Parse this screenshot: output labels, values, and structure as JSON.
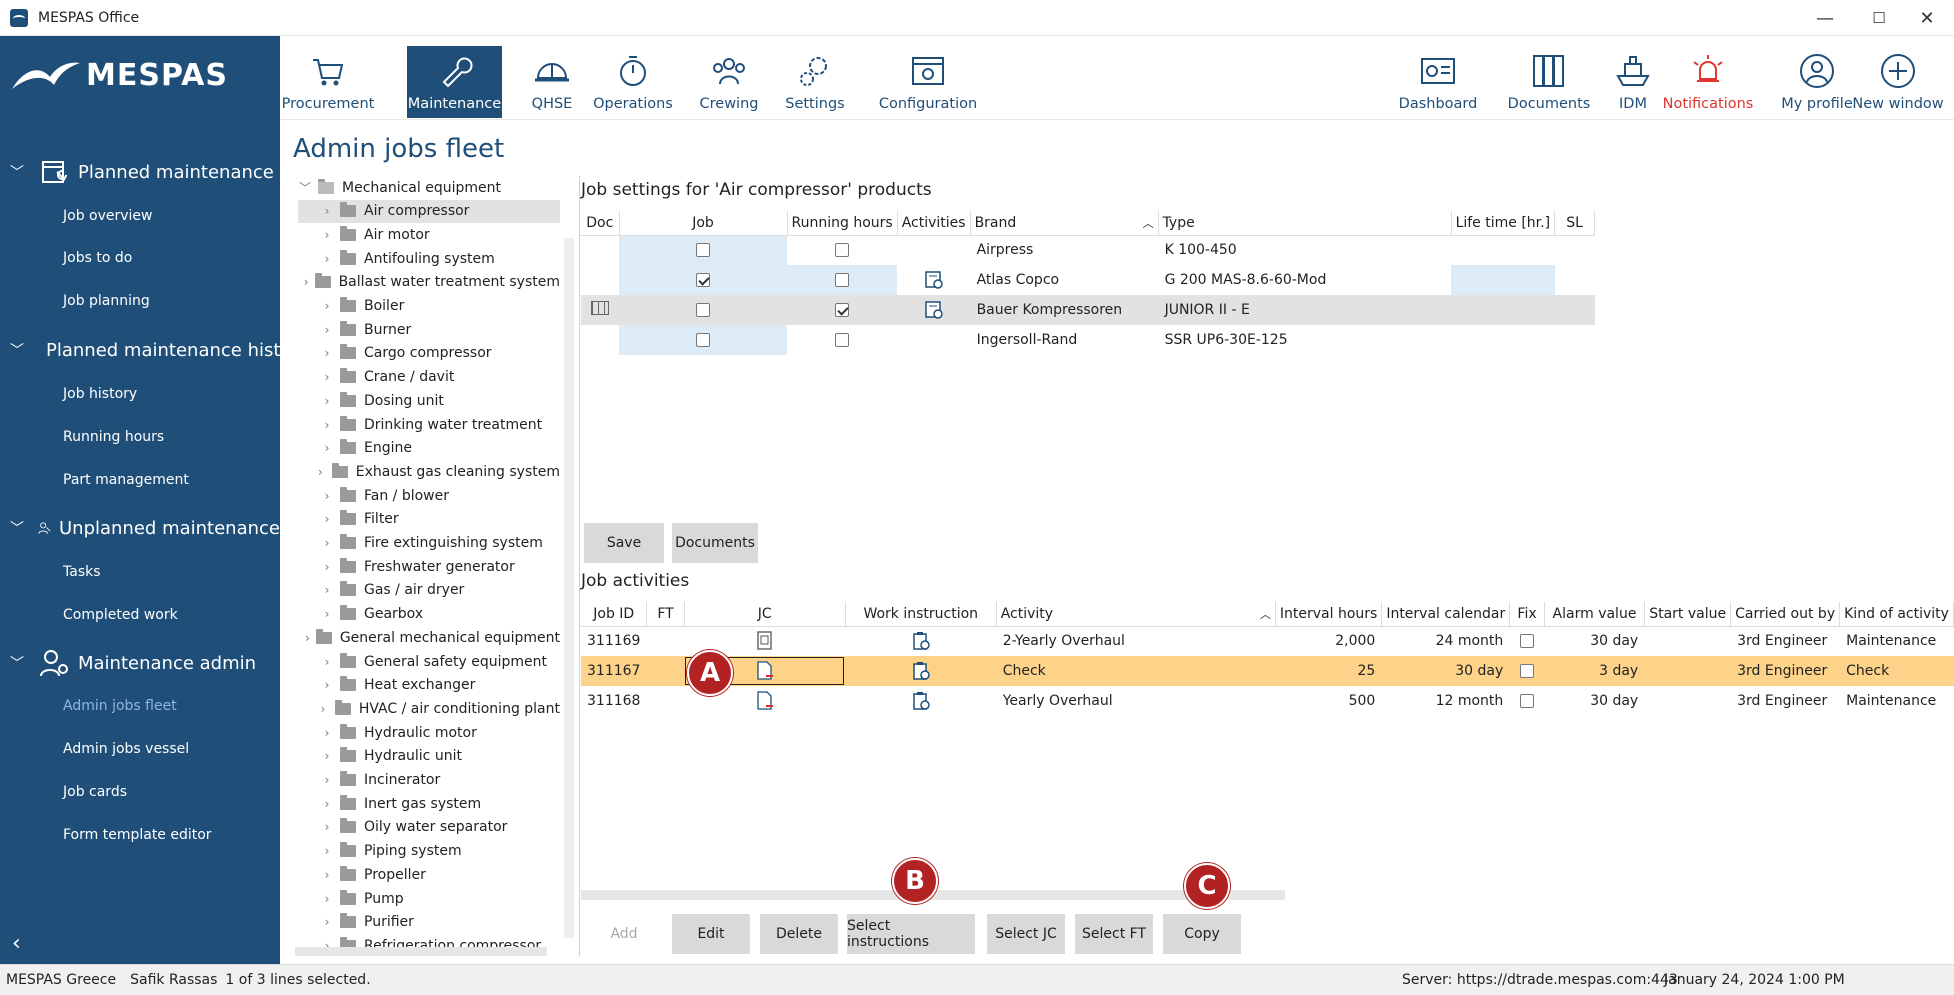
{
  "window": {
    "title": "MESPAS Office",
    "minimize": "—",
    "maximize": "☐",
    "close": "✕"
  },
  "logo": {
    "text": "MESPAS"
  },
  "sidebar": {
    "sections": [
      {
        "label": "Planned maintenance",
        "items": [
          "Job overview",
          "Jobs to do",
          "Job planning"
        ]
      },
      {
        "label": "Planned maintenance history",
        "items": [
          "Job history",
          "Running hours",
          "Part management"
        ]
      },
      {
        "label": "Unplanned maintenance",
        "items": [
          "Tasks",
          "Completed work"
        ]
      },
      {
        "label": "Maintenance admin",
        "items": [
          "Admin jobs fleet",
          "Admin jobs vessel",
          "Job cards",
          "Form template editor"
        ]
      }
    ],
    "active_item": "Admin jobs fleet",
    "collapse": "‹"
  },
  "nav": {
    "left": [
      "Procurement",
      "Maintenance",
      "QHSE",
      "Operations",
      "Crewing",
      "Settings",
      "Configuration"
    ],
    "right": [
      "Dashboard",
      "Documents",
      "IDM",
      "Notifications",
      "My profile",
      "New window"
    ],
    "active": "Maintenance"
  },
  "page": {
    "title": "Admin jobs fleet"
  },
  "tree": {
    "root": "Mechanical equipment",
    "items": [
      "Air compressor",
      "Air motor",
      "Antifouling system",
      "Ballast water treatment system",
      "Boiler",
      "Burner",
      "Cargo compressor",
      "Crane / davit",
      "Dosing unit",
      "Drinking water treatment",
      "Engine",
      "Exhaust gas cleaning system",
      "Fan / blower",
      "Filter",
      "Fire extinguishing system",
      "Freshwater generator",
      "Gas / air dryer",
      "Gearbox",
      "General mechanical equipment",
      "General safety equipment",
      "Heat exchanger",
      "HVAC / air conditioning plant",
      "Hydraulic motor",
      "Hydraulic unit",
      "Incinerator",
      "Inert gas system",
      "Oily water separator",
      "Piping system",
      "Propeller",
      "Pump",
      "Purifier",
      "Refrigeration compressor"
    ],
    "selected": "Air compressor"
  },
  "job_settings": {
    "title": "Job settings for 'Air compressor' products",
    "columns": [
      "Doc",
      "Job",
      "Running hours",
      "Activities",
      "Brand",
      "Type",
      "Life time [hr.]",
      "SL"
    ],
    "rows": [
      {
        "job": false,
        "running": false,
        "brand": "Airpress",
        "type": "K 100-450"
      },
      {
        "job": true,
        "running": false,
        "brand": "Atlas Copco",
        "type": "G 200 MAS-8.6-60-Mod"
      },
      {
        "job": false,
        "running": true,
        "brand": "Bauer Kompressoren",
        "type": "JUNIOR II - E"
      },
      {
        "job": false,
        "running": false,
        "brand": "Ingersoll-Rand",
        "type": "SSR UP6-30E-125"
      }
    ],
    "buttons": {
      "save": "Save",
      "documents": "Documents"
    }
  },
  "job_activities": {
    "title": "Job activities",
    "columns": [
      "Job ID",
      "FT",
      "JC",
      "Work instruction",
      "Activity",
      "Interval hours",
      "Interval calendar",
      "Fix",
      "Alarm value",
      "Start value",
      "Carried out by",
      "Kind of activity"
    ],
    "rows": [
      {
        "id": "311169",
        "activity": "2-Yearly Overhaul",
        "hours": "2,000",
        "calendar": "24 month",
        "alarm": "30 day",
        "by": "3rd Engineer",
        "kind": "Maintenance"
      },
      {
        "id": "311167",
        "activity": "Check",
        "hours": "25",
        "calendar": "30 day",
        "alarm": "3 day",
        "by": "3rd Engineer",
        "kind": "Check"
      },
      {
        "id": "311168",
        "activity": "Yearly Overhaul",
        "hours": "500",
        "calendar": "12 month",
        "alarm": "30 day",
        "by": "3rd Engineer",
        "kind": "Maintenance"
      }
    ],
    "buttons": {
      "add": "Add",
      "edit": "Edit",
      "delete": "Delete",
      "select_instructions": "Select instructions",
      "select_jc": "Select JC",
      "select_ft": "Select FT",
      "copy": "Copy"
    }
  },
  "badges": {
    "a": "A",
    "b": "B",
    "c": "C"
  },
  "status": {
    "company": "MESPAS Greece",
    "user": "Safik Rassas",
    "selection": "1 of 3 lines selected.",
    "server": "Server: https://dtrade.mespas.com:443",
    "datetime": "January 24, 2024 1:00 PM"
  },
  "colors": {
    "brand": "#1f4e79",
    "selected_row": "#fdd389",
    "badge": "#b22222",
    "notification": "#e0342f"
  }
}
